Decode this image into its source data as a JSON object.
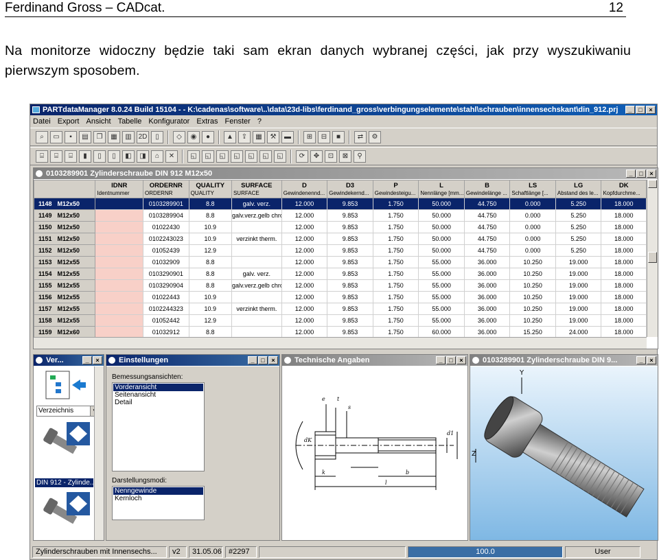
{
  "doc": {
    "header_left": "Ferdinand Gross – CADcat.",
    "page_number": "12",
    "paragraph": "Na monitorze widoczny będzie taki sam ekran danych wybranej części, jak przy wyszukiwaniu pierwszym sposobem."
  },
  "app": {
    "title": "PARTdataManager 8.0.24 Build 15104 - - K:\\cadenas\\software\\..\\data\\23d-libs\\ferdinand_gross\\verbingungselemente\\stahl\\schrauben\\innensechskant\\din_912.prj",
    "menu": [
      "Datei",
      "Export",
      "Ansicht",
      "Tabelle",
      "Konfigurator",
      "Extras",
      "Fenster",
      "?"
    ]
  },
  "table_window": {
    "title": "0103289901 Zylinderschraube DIN 912 M12x50",
    "columns": [
      {
        "name": "",
        "sub": ""
      },
      {
        "name": "IDNR",
        "sub": "Identnummer"
      },
      {
        "name": "ORDERNR",
        "sub": "ORDERNR"
      },
      {
        "name": "QUALITY",
        "sub": "QUALITY"
      },
      {
        "name": "SURFACE",
        "sub": "SURFACE"
      },
      {
        "name": "D",
        "sub": "Gewindenennd..."
      },
      {
        "name": "D3",
        "sub": "Gewindekernd..."
      },
      {
        "name": "P",
        "sub": "Gewindesteigu..."
      },
      {
        "name": "L",
        "sub": "Nennlänge [mm..."
      },
      {
        "name": "B",
        "sub": "Gewindelänge ..."
      },
      {
        "name": "LS",
        "sub": "Schaftlänge [..."
      },
      {
        "name": "LG",
        "sub": "Abstand des le..."
      },
      {
        "name": "DK",
        "sub": "Kopfdurchme..."
      }
    ],
    "rows": [
      [
        "1148",
        "M12x50",
        "",
        "0103289901",
        "8.8",
        "galv. verz.",
        "12.000",
        "9.853",
        "1.750",
        "50.000",
        "44.750",
        "0.000",
        "5.250",
        "18.000"
      ],
      [
        "1149",
        "M12x50",
        "",
        "0103289904",
        "8.8",
        "galv.verz.gelb chrom",
        "12.000",
        "9.853",
        "1.750",
        "50.000",
        "44.750",
        "0.000",
        "5.250",
        "18.000"
      ],
      [
        "1150",
        "M12x50",
        "",
        "01022430",
        "10.9",
        "",
        "12.000",
        "9.853",
        "1.750",
        "50.000",
        "44.750",
        "0.000",
        "5.250",
        "18.000"
      ],
      [
        "1151",
        "M12x50",
        "",
        "0102243023",
        "10.9",
        "verzinkt therm.",
        "12.000",
        "9.853",
        "1.750",
        "50.000",
        "44.750",
        "0.000",
        "5.250",
        "18.000"
      ],
      [
        "1152",
        "M12x50",
        "",
        "01052439",
        "12.9",
        "",
        "12.000",
        "9.853",
        "1.750",
        "50.000",
        "44.750",
        "0.000",
        "5.250",
        "18.000"
      ],
      [
        "1153",
        "M12x55",
        "",
        "01032909",
        "8.8",
        "",
        "12.000",
        "9.853",
        "1.750",
        "55.000",
        "36.000",
        "10.250",
        "19.000",
        "18.000"
      ],
      [
        "1154",
        "M12x55",
        "",
        "0103290901",
        "8.8",
        "galv. verz.",
        "12.000",
        "9.853",
        "1.750",
        "55.000",
        "36.000",
        "10.250",
        "19.000",
        "18.000"
      ],
      [
        "1155",
        "M12x55",
        "",
        "0103290904",
        "8.8",
        "galv.verz.gelb chrom",
        "12.000",
        "9.853",
        "1.750",
        "55.000",
        "36.000",
        "10.250",
        "19.000",
        "18.000"
      ],
      [
        "1156",
        "M12x55",
        "",
        "01022443",
        "10.9",
        "",
        "12.000",
        "9.853",
        "1.750",
        "55.000",
        "36.000",
        "10.250",
        "19.000",
        "18.000"
      ],
      [
        "1157",
        "M12x55",
        "",
        "0102244323",
        "10.9",
        "verzinkt therm.",
        "12.000",
        "9.853",
        "1.750",
        "55.000",
        "36.000",
        "10.250",
        "19.000",
        "18.000"
      ],
      [
        "1158",
        "M12x55",
        "",
        "01052442",
        "12.9",
        "",
        "12.000",
        "9.853",
        "1.750",
        "55.000",
        "36.000",
        "10.250",
        "19.000",
        "18.000"
      ],
      [
        "1159",
        "M12x60",
        "",
        "01032912",
        "8.8",
        "",
        "12.000",
        "9.853",
        "1.750",
        "60.000",
        "36.000",
        "15.250",
        "24.000",
        "18.000"
      ]
    ]
  },
  "pane_ver": {
    "title": "Ver...",
    "combo": "Verzeichnis",
    "selected_label": "DIN 912 - Zylinde..."
  },
  "pane_settings": {
    "title": "Einstellungen",
    "views_label": "Bemessungsansichten:",
    "views": [
      "Vorderansicht",
      "Seitenansicht",
      "Detail"
    ],
    "mode_label": "Darstellungsmodi:",
    "modes": [
      "Nenngewinde",
      "Kernloch"
    ]
  },
  "pane_tech": {
    "title": "Technische Angaben",
    "dims": [
      "d1",
      "b",
      "k",
      "l",
      "dK",
      "s",
      "e",
      "t"
    ]
  },
  "pane_3d": {
    "title": "0103289901 Zylinderschraube DIN 9...",
    "axis_y": "Y",
    "axis_z": "Z"
  },
  "status": {
    "desc": "Zylinderschrauben mit Innensechs...",
    "version": "v2",
    "date": "31.05.06",
    "id": "#2297",
    "progress": "100.0",
    "progress_value": 100,
    "user": "User"
  },
  "colors": {
    "title_active": "#0a246a",
    "selection": "#0a246a",
    "idnr_cell": "#f8d0c8",
    "chrome": "#d4d0c8"
  }
}
